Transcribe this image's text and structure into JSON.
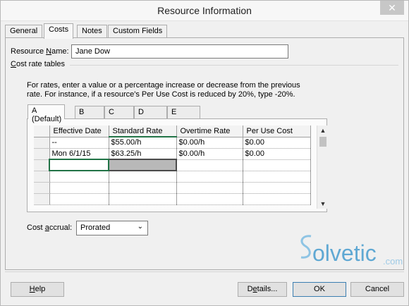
{
  "window": {
    "title": "Resource Information",
    "close_glyph": "✕"
  },
  "tabs": [
    {
      "label": "General",
      "active": false
    },
    {
      "label": "Costs",
      "active": true
    },
    {
      "label": "Notes",
      "active": false
    },
    {
      "label": "Custom Fields",
      "active": false
    }
  ],
  "resource_name": {
    "label_pre": "Resource ",
    "label_u": "N",
    "label_post": "ame:",
    "value": "Jane Dow"
  },
  "cost_rate_tables": {
    "heading_u": "C",
    "heading_post": "ost rate tables",
    "instructions_line1": "For rates, enter a value or a percentage increase or decrease from the previous",
    "instructions_line2": "rate. For instance, if a resource's Per Use Cost is reduced by 20%, type -20%.",
    "tabs": [
      "A (Default)",
      "B",
      "C",
      "D",
      "E"
    ],
    "columns": [
      "Effective Date",
      "Standard Rate",
      "Overtime Rate",
      "Per Use Cost"
    ],
    "rows": [
      [
        "--",
        "$55.00/h",
        "$0.00/h",
        "$0.00"
      ],
      [
        "Mon 6/1/15",
        "$63.25/h",
        "$0.00/h",
        "$0.00"
      ],
      [
        "",
        "",
        "",
        ""
      ],
      [
        "",
        "",
        "",
        ""
      ],
      [
        "",
        "",
        "",
        ""
      ],
      [
        "",
        "",
        "",
        ""
      ]
    ]
  },
  "cost_accrual": {
    "label_pre": "Cost ",
    "label_u": "a",
    "label_post": "ccrual:",
    "value": "Prorated"
  },
  "watermark": {
    "text": "olvetic",
    "suffix": ".com",
    "color": "#5fa8d3"
  },
  "buttons": {
    "help": {
      "u": "H",
      "post": "elp"
    },
    "details": {
      "pre": "D",
      "u": "e",
      "post": "tails..."
    },
    "ok": "OK",
    "cancel": "Cancel"
  }
}
